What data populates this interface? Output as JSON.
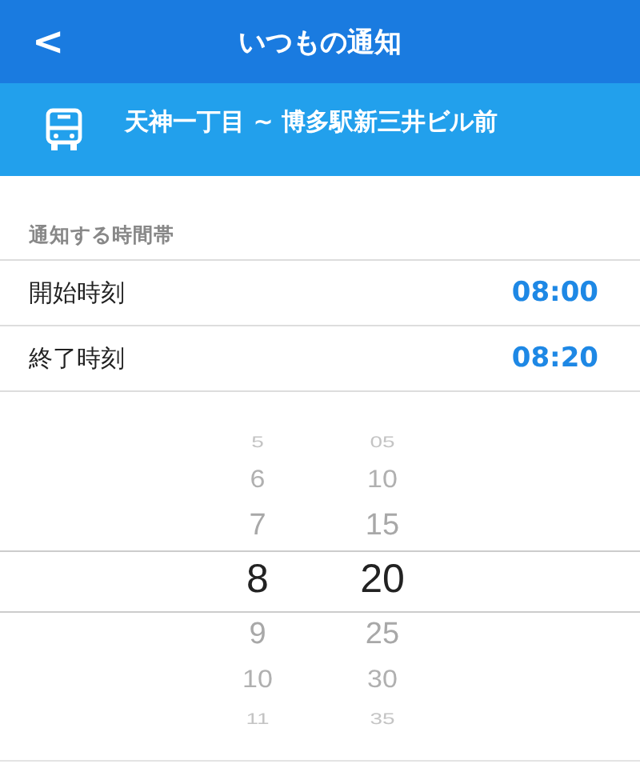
{
  "header": {
    "back": "<",
    "title": "いつもの通知"
  },
  "route": {
    "text": "天神一丁目 ~ 博多駅新三井ビル前"
  },
  "section": {
    "label": "通知する時間帯"
  },
  "rows": [
    {
      "label": "開始時刻",
      "value": "08:00"
    },
    {
      "label": "終了時刻",
      "value": "08:20"
    }
  ],
  "picker": {
    "columns": [
      {
        "items": [
          {
            "text": "5",
            "selected": false
          },
          {
            "text": "6",
            "selected": false
          },
          {
            "text": "7",
            "selected": false
          },
          {
            "text": "8",
            "selected": true
          },
          {
            "text": "9",
            "selected": false
          },
          {
            "text": "10",
            "selected": false
          },
          {
            "text": "11",
            "selected": false
          }
        ]
      },
      {
        "items": [
          {
            "text": "05",
            "selected": false
          },
          {
            "text": "10",
            "selected": false
          },
          {
            "text": "15",
            "selected": false
          },
          {
            "text": "20",
            "selected": true
          },
          {
            "text": "25",
            "selected": false
          },
          {
            "text": "30",
            "selected": false
          },
          {
            "text": "35",
            "selected": false
          }
        ]
      }
    ]
  }
}
